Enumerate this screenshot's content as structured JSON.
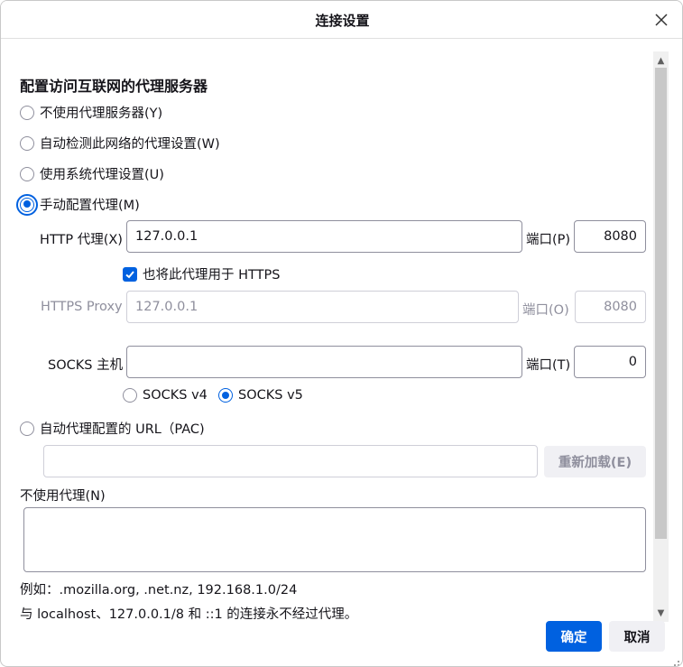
{
  "dialog": {
    "title": "连接设置"
  },
  "section": {
    "title": "配置访问互联网的代理服务器"
  },
  "proxy_options": {
    "no_proxy": "不使用代理服务器(Y)",
    "auto_detect": "自动检测此网络的代理设置(W)",
    "system": "使用系统代理设置(U)",
    "manual": "手动配置代理(M)",
    "pac": "自动代理配置的 URL（PAC)"
  },
  "http": {
    "label": "HTTP 代理(X)",
    "value": "127.0.0.1",
    "port_label": "端口(P)",
    "port": "8080"
  },
  "also_https": {
    "label": "也将此代理用于 HTTPS"
  },
  "https": {
    "label": "HTTPS Proxy",
    "value": "127.0.0.1",
    "port_label": "端口(O)",
    "port": "8080"
  },
  "socks": {
    "label": "SOCKS 主机",
    "value": "",
    "port_label": "端口(T)",
    "port": "0",
    "v4": "SOCKS v4",
    "v5": "SOCKS v5"
  },
  "pac": {
    "value": "",
    "reload_label": "重新加载(E)"
  },
  "no_proxy_for": {
    "label": "不使用代理(N)",
    "value": ""
  },
  "hints": {
    "example": "例如：.mozilla.org, .net.nz, 192.168.1.0/24",
    "localhost": "与 localhost、127.0.0.1/8 和 ::1 的连接永不经过代理。"
  },
  "buttons": {
    "ok": "确定",
    "cancel": "取消"
  },
  "colors": {
    "accent": "#0061e0",
    "text": "#15141a",
    "disabled": "#8f8f9d"
  }
}
